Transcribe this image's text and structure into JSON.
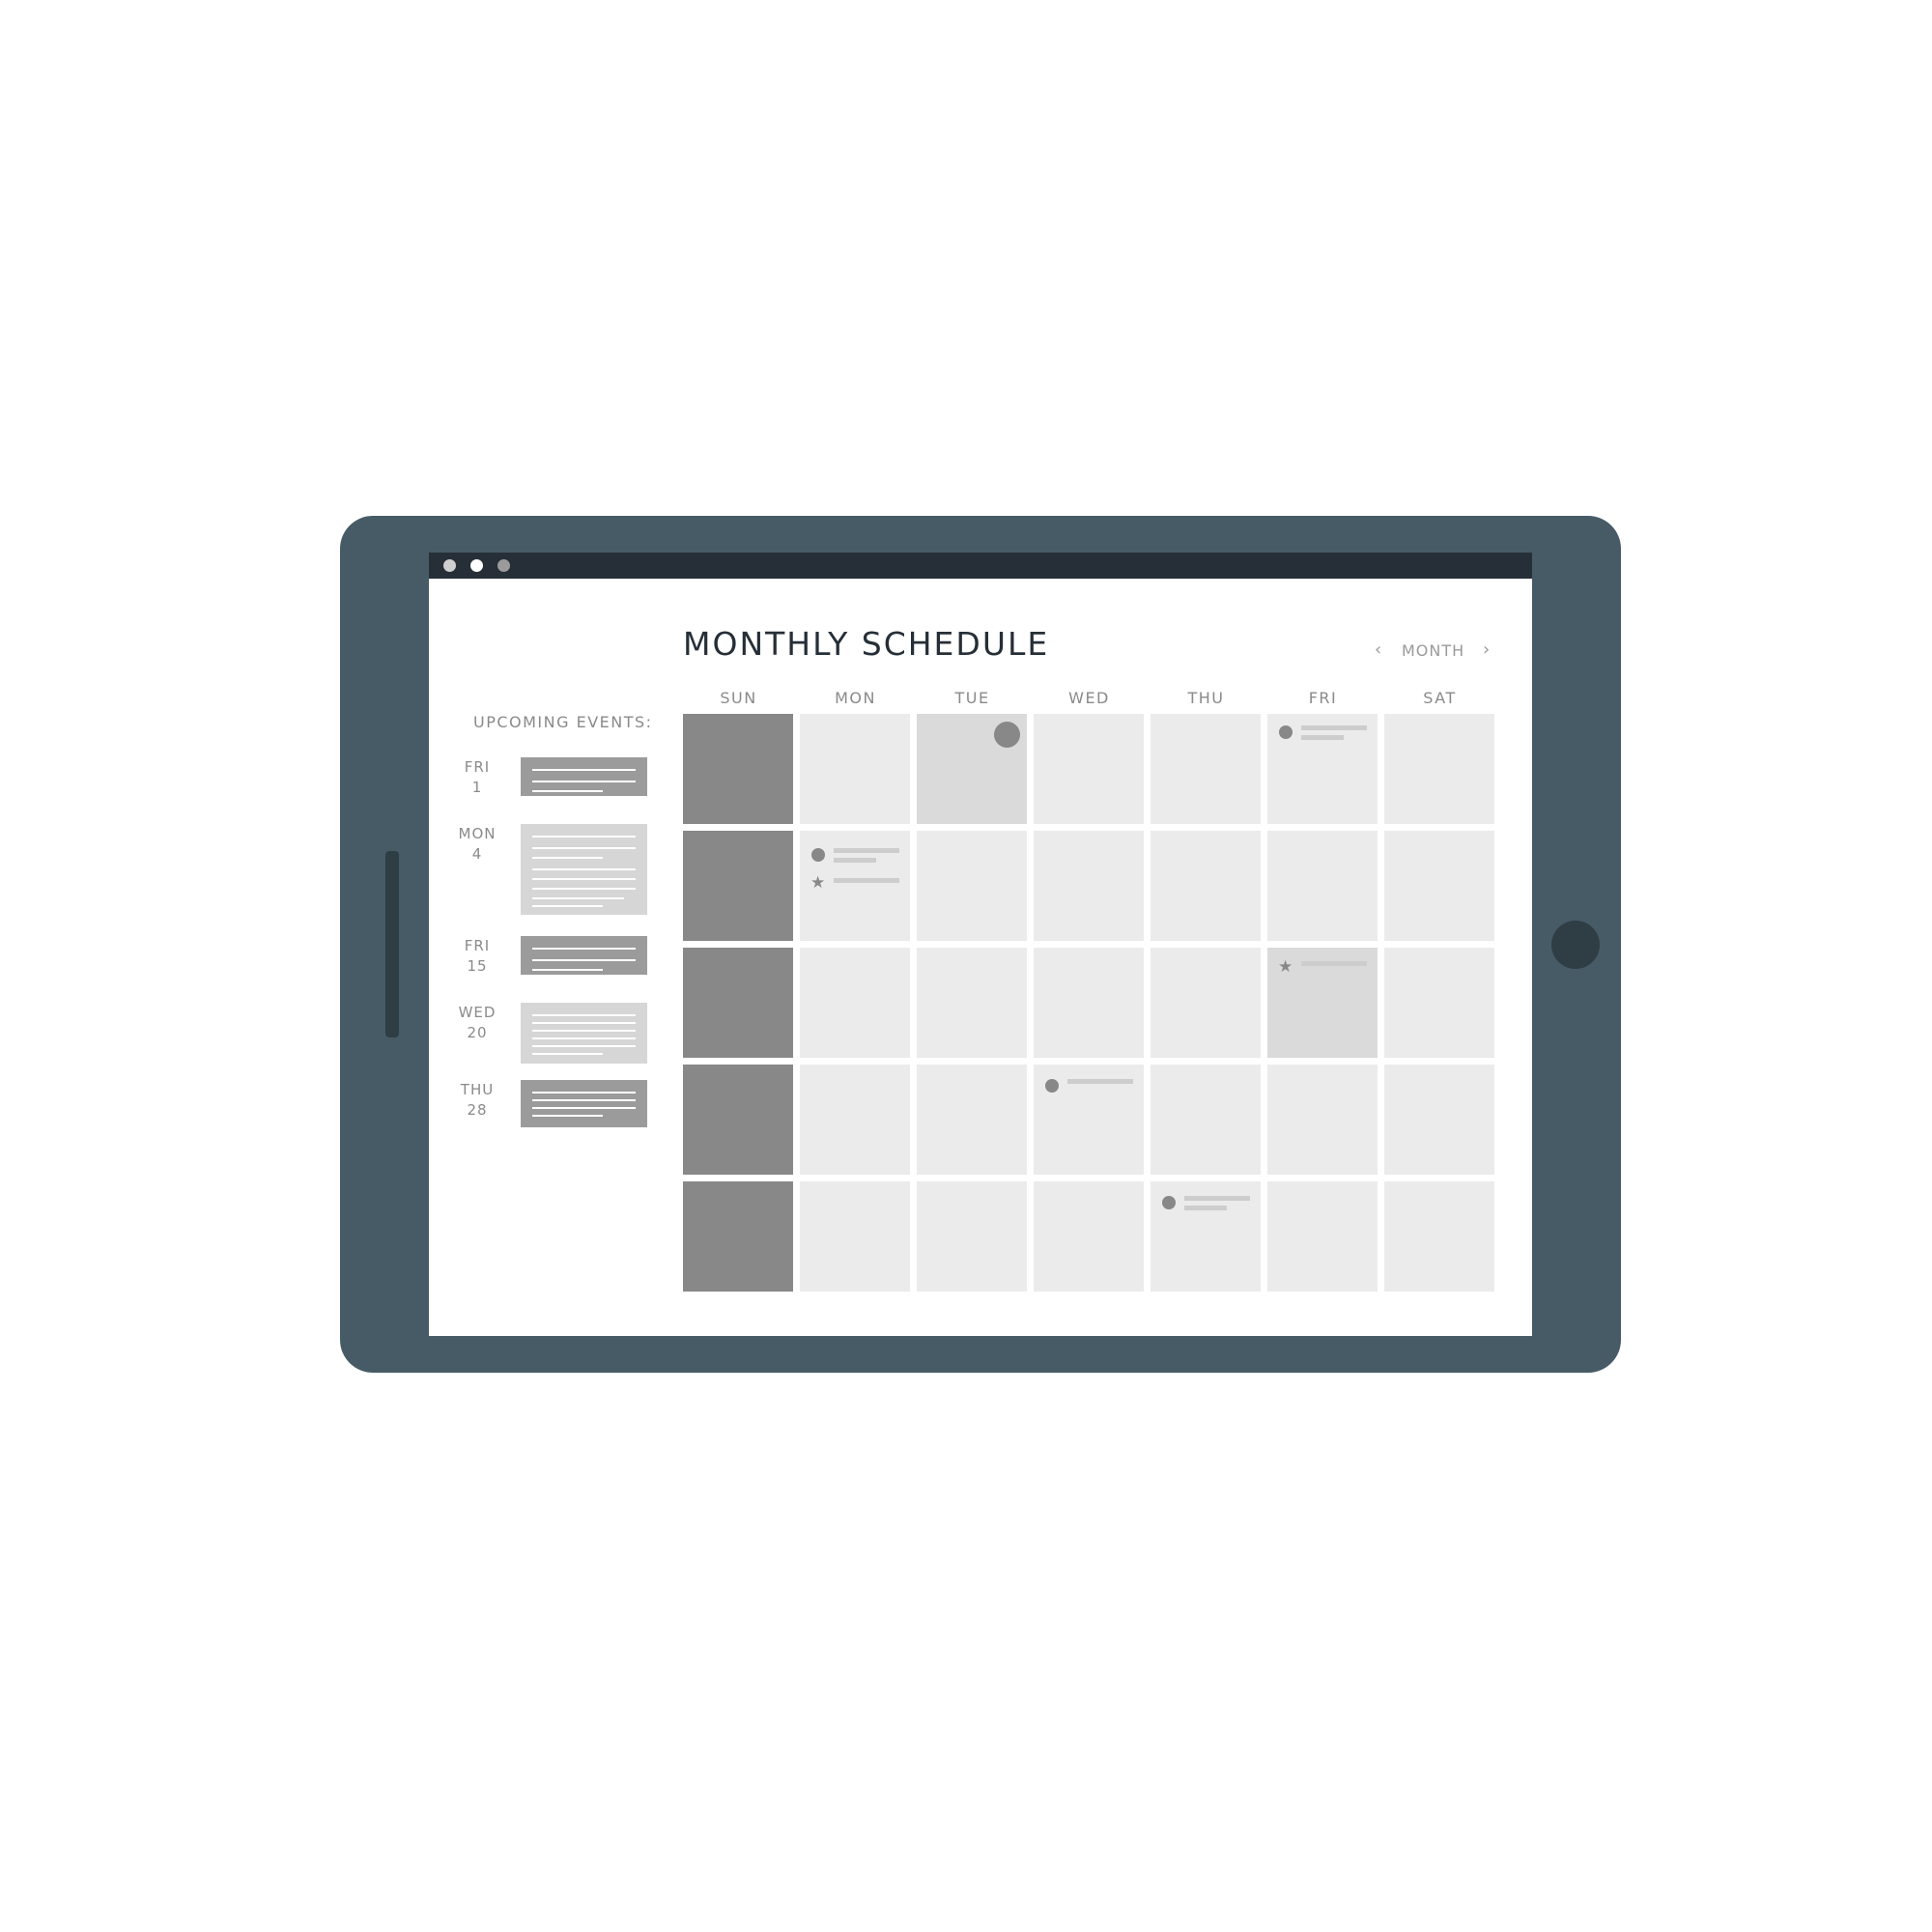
{
  "window": {
    "dots": [
      "#cfcfcf",
      "#ffffff",
      "#9b9b9b"
    ]
  },
  "header": {
    "title": "MONTHLY SCHEDULE",
    "nav_label": "MONTH",
    "prev_icon": "chevron-left-icon",
    "next_icon": "chevron-right-icon",
    "prev_glyph": "‹",
    "next_glyph": "›"
  },
  "sidebar": {
    "label": "UPCOMING EVENTS:",
    "events": [
      {
        "day": "FRI",
        "date": "1",
        "style": "dark"
      },
      {
        "day": "MON",
        "date": "4",
        "style": "light"
      },
      {
        "day": "FRI",
        "date": "15",
        "style": "dark"
      },
      {
        "day": "WED",
        "date": "20",
        "style": "light"
      },
      {
        "day": "THU",
        "date": "28",
        "style": "dark"
      }
    ]
  },
  "calendar": {
    "days": [
      "SUN",
      "MON",
      "TUE",
      "WED",
      "THU",
      "FRI",
      "SAT"
    ],
    "weeks": 5,
    "highlighted_cells": [
      [
        0,
        2
      ],
      [
        2,
        5
      ]
    ],
    "cell_markers": [
      {
        "week": 0,
        "day": 2,
        "icon": "circle-icon"
      },
      {
        "week": 0,
        "day": 5,
        "icon": "circle-icon"
      },
      {
        "week": 1,
        "day": 1,
        "icon": "circle-icon"
      },
      {
        "week": 1,
        "day": 1,
        "icon": "star-icon"
      },
      {
        "week": 2,
        "day": 5,
        "icon": "star-icon"
      },
      {
        "week": 3,
        "day": 3,
        "icon": "circle-icon"
      },
      {
        "week": 4,
        "day": 4,
        "icon": "circle-icon"
      }
    ],
    "colors": {
      "cell": "#ebebeb",
      "sunday": "#888888",
      "highlight": "#dadada",
      "marker": "#888888"
    }
  }
}
